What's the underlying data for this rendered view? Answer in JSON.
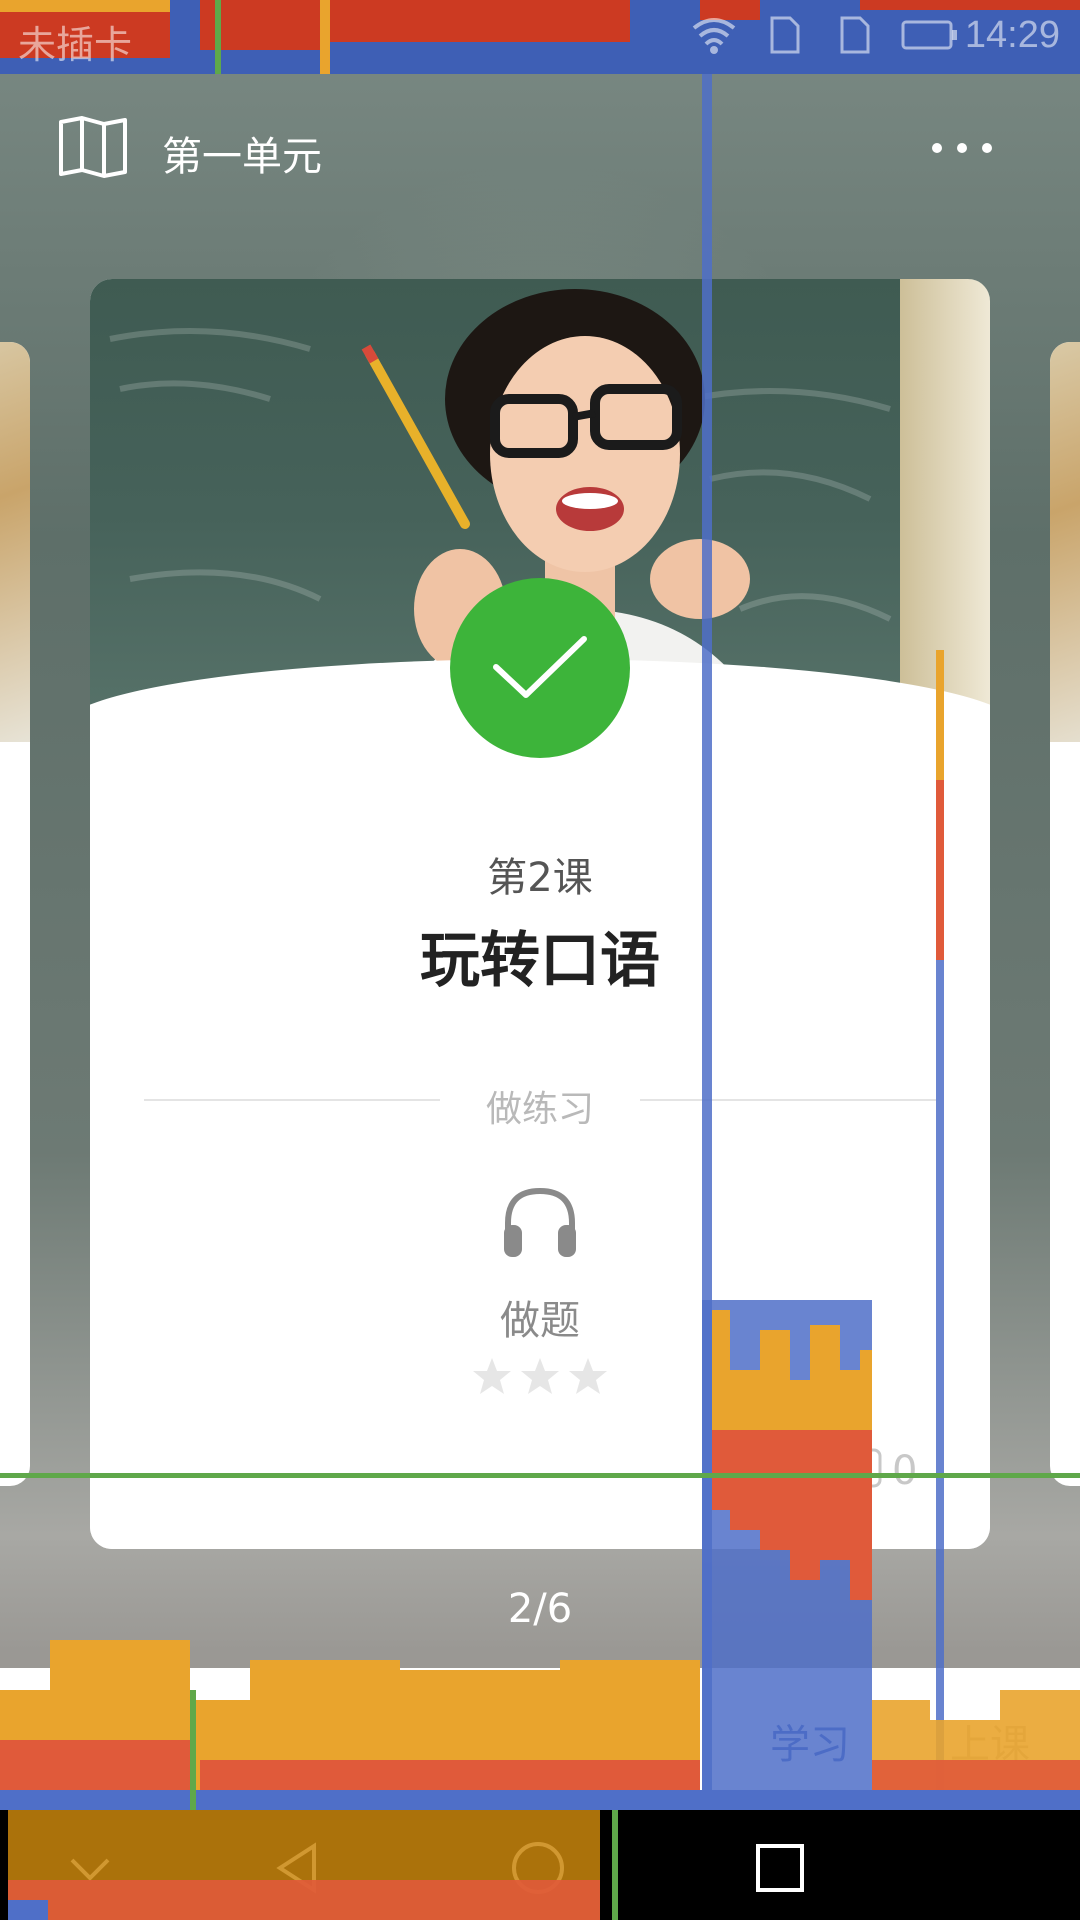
{
  "status_bar": {
    "carrier": "未插卡",
    "time": "14:29",
    "icons": [
      "shield-icon",
      "sim-card-icon",
      "android-icon",
      "wifi-icon",
      "sim-card-icon",
      "sim-card-icon",
      "battery-icon"
    ]
  },
  "header": {
    "title": "第一单元",
    "left_icon": "book-icon",
    "right_icon": "more-icon"
  },
  "lesson_card": {
    "lesson_number": "第2课",
    "lesson_title": "玩转口语",
    "section_label": "做练习",
    "exercise": {
      "icon": "headphones-icon",
      "label": "做题",
      "stars_total": 3,
      "stars_filled": 0
    },
    "completed_badge_icon": "checkmark-icon",
    "comment_count": "0"
  },
  "pager": {
    "label": "2/6"
  },
  "tab_bar": {
    "back_icon": "chevron-left-icon",
    "tabs": [
      {
        "label": "学习",
        "active": true
      },
      {
        "label": "上课",
        "active": false
      }
    ]
  },
  "navigation_bar": {
    "buttons": [
      "chevron-down-icon",
      "back-triangle-icon",
      "home-circle-icon",
      "recent-square-icon"
    ]
  },
  "colors": {
    "accent": "#3d5fb8",
    "complete_green": "#3db43a",
    "gpu_blue": "#4f6fc8",
    "gpu_red": "#e05a3a",
    "gpu_orange": "#e9a42d",
    "gpu_green": "#5fa84a"
  }
}
